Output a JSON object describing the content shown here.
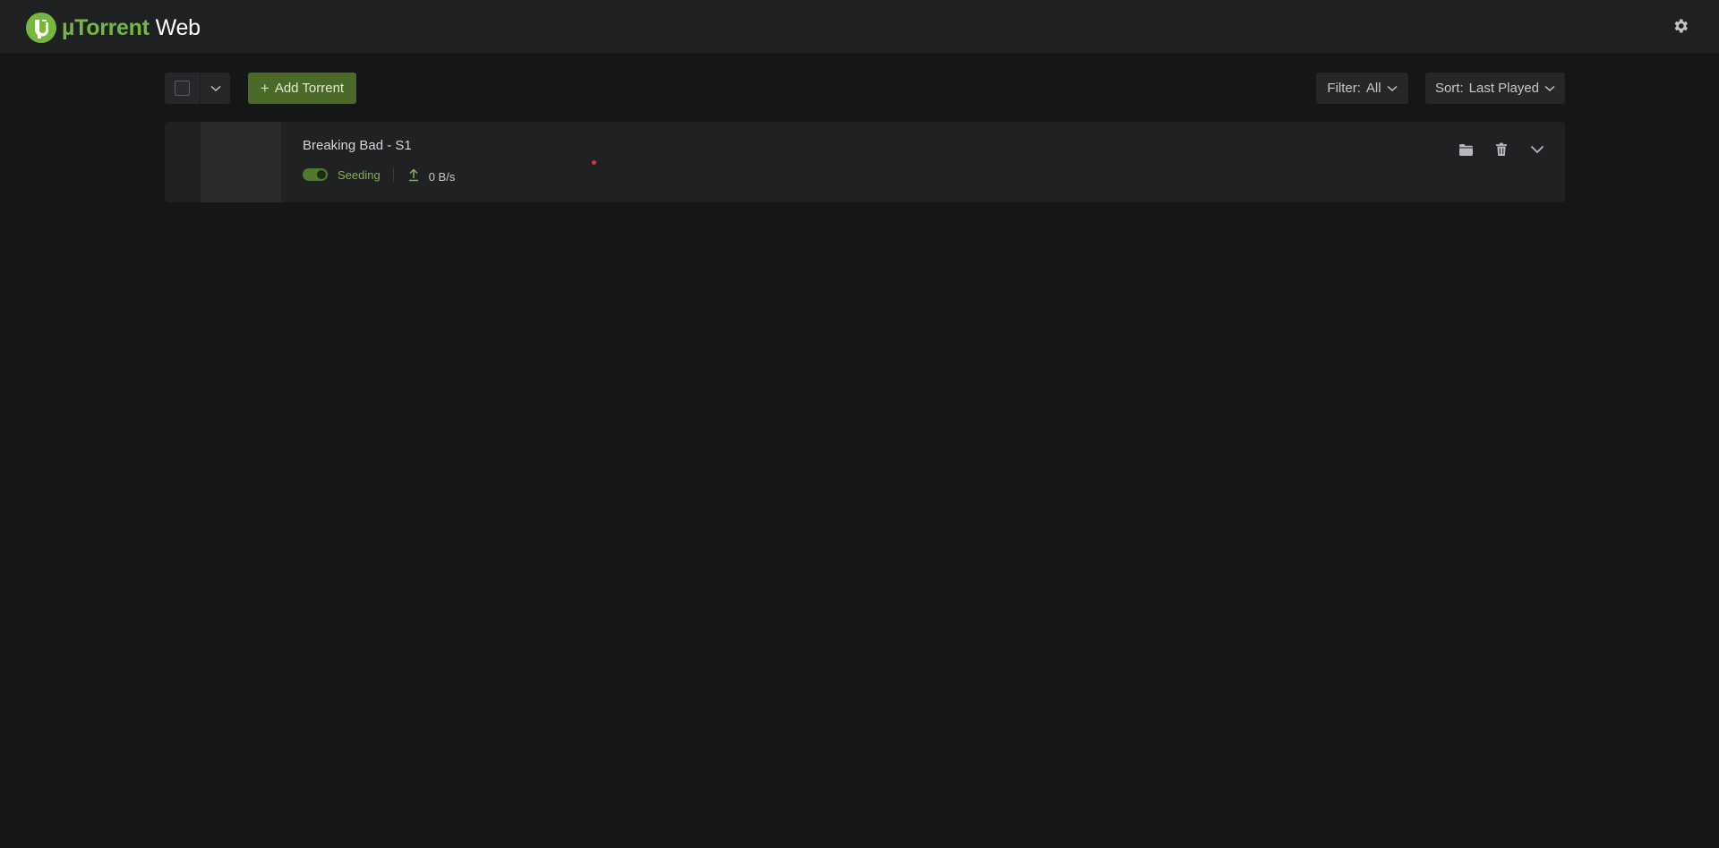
{
  "app": {
    "brand": "µTorrent",
    "product": "Web"
  },
  "toolbar": {
    "add_label": "Add Torrent",
    "filter_label": "Filter:",
    "filter_value": "All",
    "sort_label": "Sort:",
    "sort_value": "Last Played"
  },
  "torrents": [
    {
      "name": "Breaking Bad - S1",
      "status": "Seeding",
      "upload_speed": "0 B/s",
      "seeding_enabled": true
    }
  ],
  "colors": {
    "accent": "#76b83f",
    "add_button": "#4b6a28",
    "status_seeding": "#7fb548",
    "notification_dot": "#e0302e"
  },
  "icons": {
    "logo": "utorrent-logo-icon",
    "settings": "gear-icon",
    "select_caret": "chevron-down-icon",
    "add": "plus-icon",
    "upload": "upload-arrow-icon",
    "open_folder": "folder-icon",
    "delete": "trash-icon",
    "expand": "chevron-down-icon"
  }
}
